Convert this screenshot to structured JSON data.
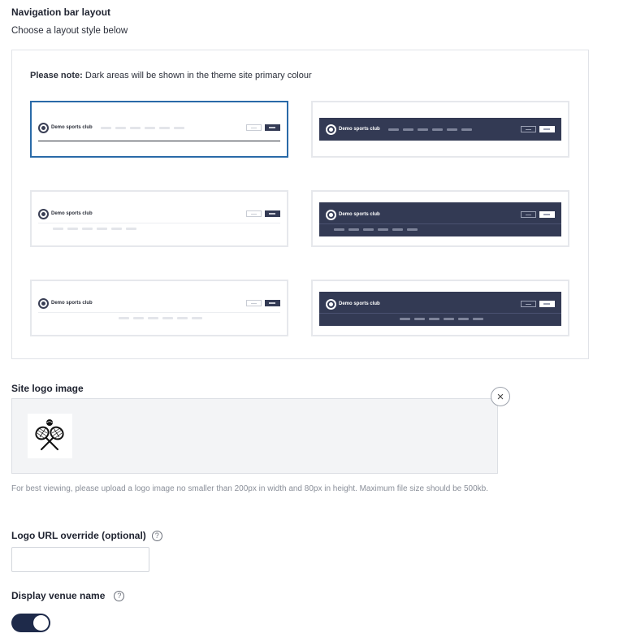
{
  "nav_layout": {
    "title": "Navigation bar layout",
    "subtitle": "Choose a layout style below",
    "note_label": "Please note:",
    "note_text": " Dark areas will be shown in the theme site primary colour",
    "preview_brand": "Demo sports club",
    "selected_option": 1,
    "options": [
      {
        "id": 1,
        "style": "light-inline",
        "selected": true
      },
      {
        "id": 2,
        "style": "dark-inline",
        "selected": false
      },
      {
        "id": 3,
        "style": "light-two-row-left-links",
        "selected": false
      },
      {
        "id": 4,
        "style": "dark-two-row-left-links",
        "selected": false
      },
      {
        "id": 5,
        "style": "light-two-row-centered-links",
        "selected": false
      },
      {
        "id": 6,
        "style": "dark-two-row-centered-links",
        "selected": false
      }
    ]
  },
  "logo_image": {
    "title": "Site logo image",
    "remove_icon": "×",
    "image_icon": "tennis-rackets-icon",
    "hint": "For best viewing, please upload a logo image no smaller than 200px in width and 80px in height. Maximum file size should be 500kb."
  },
  "logo_url": {
    "label": "Logo URL override (optional)",
    "help_icon": "?",
    "value": "",
    "placeholder": ""
  },
  "venue_name": {
    "label": "Display venue name",
    "help_icon": "?",
    "enabled": true
  },
  "colors": {
    "primary_dark": "#333a54",
    "selected_border": "#2a6aa8",
    "toggle_on": "#1e2a4a"
  }
}
